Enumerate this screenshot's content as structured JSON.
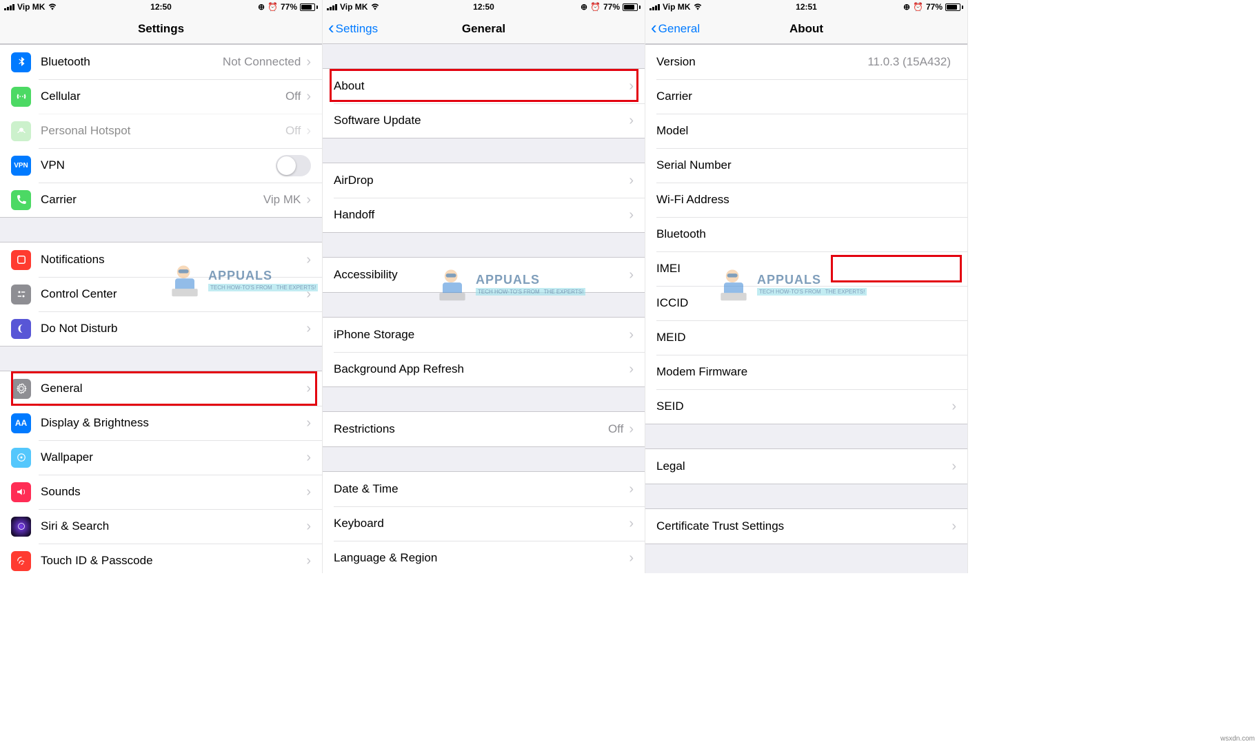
{
  "status": {
    "carrier": "Vip MK",
    "time_a": "12:50",
    "time_b": "12:50",
    "time_c": "12:51",
    "battery_pct": "77%"
  },
  "screen1": {
    "title": "Settings",
    "rows": {
      "bluetooth": {
        "label": "Bluetooth",
        "detail": "Not Connected"
      },
      "cellular": {
        "label": "Cellular",
        "detail": "Off"
      },
      "hotspot": {
        "label": "Personal Hotspot",
        "detail": "Off"
      },
      "vpn": {
        "label": "VPN"
      },
      "carrier": {
        "label": "Carrier",
        "detail": "Vip MK"
      },
      "notifications": {
        "label": "Notifications"
      },
      "control": {
        "label": "Control Center"
      },
      "dnd": {
        "label": "Do Not Disturb"
      },
      "general": {
        "label": "General"
      },
      "display": {
        "label": "Display & Brightness"
      },
      "wallpaper": {
        "label": "Wallpaper"
      },
      "sounds": {
        "label": "Sounds"
      },
      "siri": {
        "label": "Siri & Search"
      },
      "touchid": {
        "label": "Touch ID & Passcode"
      }
    }
  },
  "screen2": {
    "back": "Settings",
    "title": "General",
    "rows": {
      "about": "About",
      "software": "Software Update",
      "airdrop": "AirDrop",
      "handoff": "Handoff",
      "accessibility": "Accessibility",
      "storage": "iPhone Storage",
      "background": "Background App Refresh",
      "restrictions": {
        "label": "Restrictions",
        "detail": "Off"
      },
      "datetime": "Date & Time",
      "keyboard": "Keyboard",
      "language": "Language & Region"
    }
  },
  "screen3": {
    "back": "General",
    "title": "About",
    "rows": {
      "version": {
        "label": "Version",
        "detail": "11.0.3 (15A432)"
      },
      "carrier": "Carrier",
      "model": "Model",
      "serial": "Serial Number",
      "wifi": "Wi-Fi Address",
      "bluetooth": "Bluetooth",
      "imei": "IMEI",
      "iccid": "ICCID",
      "meid": "MEID",
      "modem": "Modem Firmware",
      "seid": "SEID",
      "legal": "Legal",
      "cert": "Certificate Trust Settings"
    }
  },
  "watermark": {
    "brand": "APPUALS",
    "tagline1": "TECH HOW-TO'S FROM",
    "tagline2": "THE EXPERTS!"
  },
  "footer": "wsxdn.com",
  "vpn_badge": "VPN",
  "aa_badge": "AA"
}
